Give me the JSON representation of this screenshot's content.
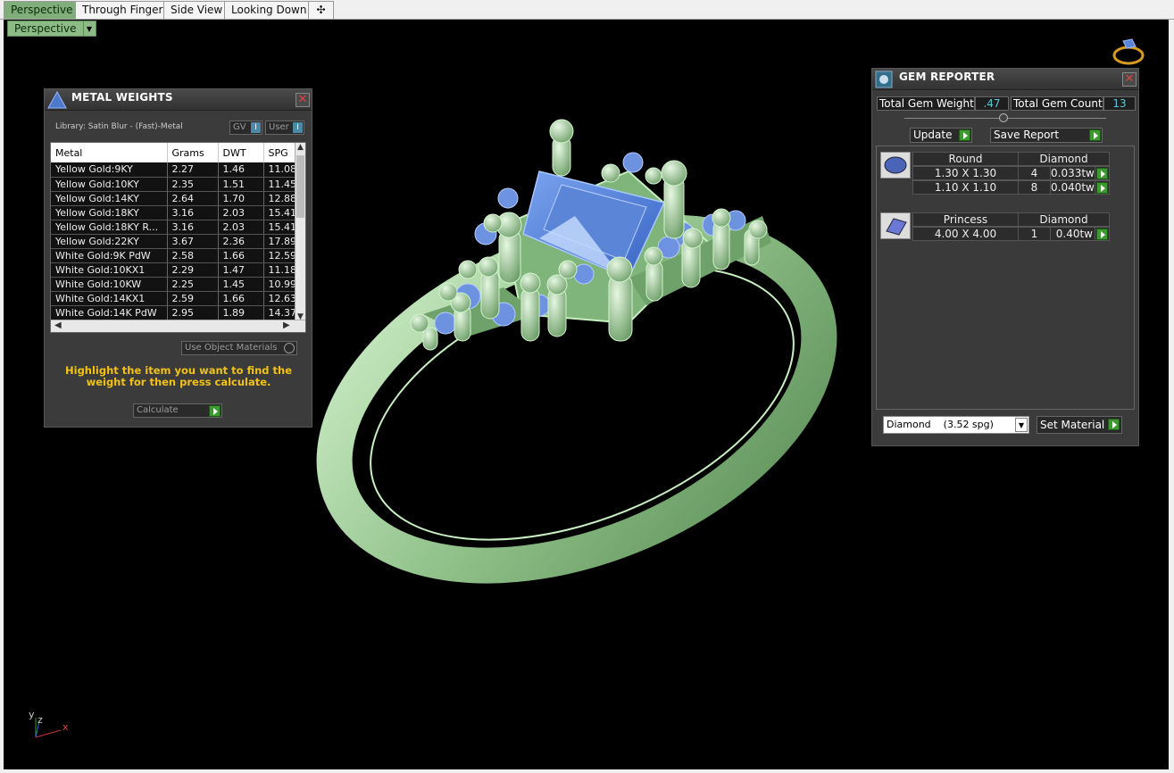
{
  "tabs": [
    "Perspective",
    "Through Finger",
    "Side View",
    "Looking Down"
  ],
  "view_dropdown": "Perspective",
  "metal_weights": {
    "title": "METAL WEIGHTS",
    "library": "Library: Satin Blur - (Fast)-Metal",
    "gv_label": "GV",
    "user_label": "User",
    "columns": [
      "Metal",
      "Grams",
      "DWT",
      "SPG"
    ],
    "rows": [
      [
        "Yellow Gold:9KY",
        "2.27",
        "1.46",
        "11.08"
      ],
      [
        "Yellow Gold:10KY",
        "2.35",
        "1.51",
        "11.45"
      ],
      [
        "Yellow Gold:14KY",
        "2.64",
        "1.70",
        "12.88"
      ],
      [
        "Yellow Gold:18KY",
        "3.16",
        "2.03",
        "15.41"
      ],
      [
        "Yellow Gold:18KY R...",
        "3.16",
        "2.03",
        "15.41"
      ],
      [
        "Yellow Gold:22KY",
        "3.67",
        "2.36",
        "17.89"
      ],
      [
        "White Gold:9K PdW",
        "2.58",
        "1.66",
        "12.59"
      ],
      [
        "White Gold:10KX1",
        "2.29",
        "1.47",
        "11.18"
      ],
      [
        "White Gold:10KW",
        "2.25",
        "1.45",
        "10.99"
      ],
      [
        "White Gold:14KX1",
        "2.59",
        "1.66",
        "12.63"
      ],
      [
        "White Gold:14K PdW",
        "2.95",
        "1.89",
        "14.37"
      ]
    ],
    "use_object_materials": "Use Object Materials",
    "instruction": "Highlight the item you want to find the weight for then press calculate.",
    "calculate": "Calculate"
  },
  "gem_reporter": {
    "title": "GEM REPORTER",
    "total_weight_label": "Total Gem Weight",
    "total_weight_value": ".47",
    "total_count_label": "Total Gem Count",
    "total_count_value": "13",
    "update": "Update",
    "save_report": "Save Report",
    "groups": [
      {
        "shape": "Round",
        "material": "Diamond",
        "icon": "round-gem-icon",
        "rows": [
          [
            "1.30 X 1.30",
            "4",
            "0.033tw"
          ],
          [
            "1.10 X 1.10",
            "8",
            "0.040tw"
          ]
        ]
      },
      {
        "shape": "Princess",
        "material": "Diamond",
        "icon": "princess-gem-icon",
        "rows": [
          [
            "4.00 X 4.00",
            "1",
            "0.40tw"
          ]
        ]
      }
    ],
    "material_select": "Diamond    (3.52 spg)",
    "set_material": "Set Material"
  },
  "axis": {
    "y": "y",
    "z": "z",
    "x": "x"
  },
  "colors": {
    "metal": "#a9d9a3",
    "gem": "#5b86d8",
    "tab_active": "#7fae7a"
  }
}
